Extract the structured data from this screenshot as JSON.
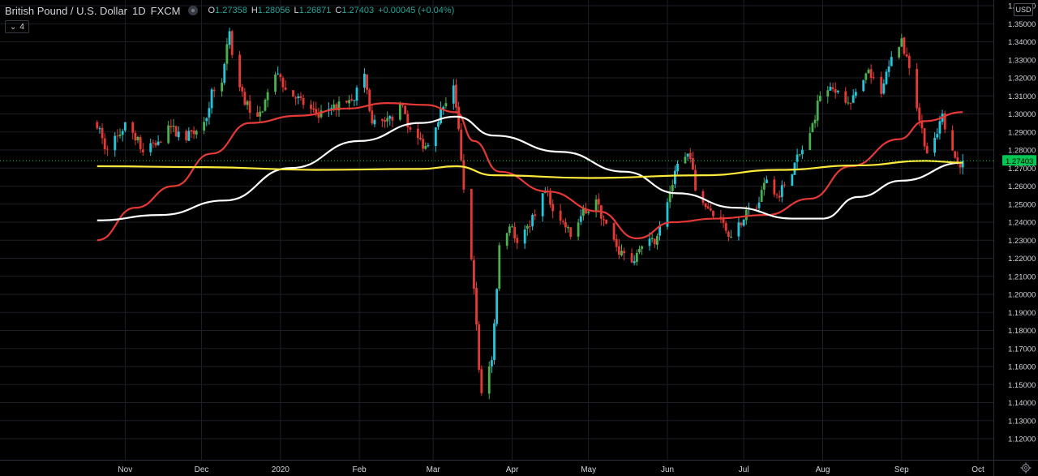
{
  "header": {
    "symbol": "British Pound / U.S. Dollar",
    "interval": "1D",
    "exchange": "FXCM",
    "o_label": "O",
    "o_val": "1.27358",
    "h_label": "H",
    "h_val": "1.28056",
    "l_label": "L",
    "l_val": "1.26871",
    "c_label": "C",
    "c_val": "1.27403",
    "change": "+0.00045 (+0.04%)"
  },
  "indicator_badge": "4",
  "currency": "USD",
  "colors": {
    "up": "#26c6da",
    "down": "#e53935",
    "up_alt": "#4caf50",
    "ema_red": "#e53935",
    "sma_white": "#ffffff",
    "sma_yellow": "#ffeb3b",
    "price_label_bg": "#00c853",
    "grid": "#1c1f26",
    "axis_text": "#d1d4dc"
  },
  "chart_data": {
    "type": "candlestick",
    "title": "British Pound / U.S. Dollar 1D FXCM",
    "x_ticks": [
      "Nov",
      "Dec",
      "2020",
      "Feb",
      "Mar",
      "Apr",
      "May",
      "Jun",
      "Jul",
      "Aug",
      "Sep",
      "Oct"
    ],
    "y_ticks": [
      "1.36000",
      "1.35000",
      "1.34000",
      "1.33000",
      "1.32000",
      "1.31000",
      "1.30000",
      "1.29000",
      "1.28000",
      "1.27000",
      "1.26000",
      "1.25000",
      "1.24000",
      "1.23000",
      "1.22000",
      "1.21000",
      "1.20000",
      "1.19000",
      "1.18000",
      "1.17000",
      "1.16000",
      "1.15000",
      "1.14000",
      "1.13000",
      "1.12000"
    ],
    "ylim": [
      1.12,
      1.36
    ],
    "last_price": "1.27403",
    "last_price_value": 1.27403,
    "close_path": [
      [
        "2019-10-21",
        1.295
      ],
      [
        "2019-10-24",
        1.282
      ],
      [
        "2019-10-29",
        1.287
      ],
      [
        "2019-11-01",
        1.294
      ],
      [
        "2019-11-05",
        1.288
      ],
      [
        "2019-11-08",
        1.278
      ],
      [
        "2019-11-13",
        1.284
      ],
      [
        "2019-11-19",
        1.292
      ],
      [
        "2019-11-25",
        1.287
      ],
      [
        "2019-11-29",
        1.292
      ],
      [
        "2019-12-02",
        1.294
      ],
      [
        "2019-12-05",
        1.312
      ],
      [
        "2019-12-09",
        1.317
      ],
      [
        "2019-12-12",
        1.345
      ],
      [
        "2019-12-13",
        1.33
      ],
      [
        "2019-12-18",
        1.308
      ],
      [
        "2019-12-23",
        1.296
      ],
      [
        "2019-12-27",
        1.311
      ],
      [
        "2019-12-31",
        1.324
      ],
      [
        "2020-01-03",
        1.313
      ],
      [
        "2020-01-09",
        1.307
      ],
      [
        "2020-01-14",
        1.3
      ],
      [
        "2020-01-20",
        1.301
      ],
      [
        "2020-01-24",
        1.305
      ],
      [
        "2020-01-30",
        1.31
      ],
      [
        "2020-02-03",
        1.322
      ],
      [
        "2020-02-06",
        1.294
      ],
      [
        "2020-02-12",
        1.296
      ],
      [
        "2020-02-18",
        1.305
      ],
      [
        "2020-02-21",
        1.29
      ],
      [
        "2020-02-27",
        1.282
      ],
      [
        "2020-03-03",
        1.298
      ],
      [
        "2020-03-09",
        1.317
      ],
      [
        "2020-03-11",
        1.29
      ],
      [
        "2020-03-13",
        1.256
      ],
      [
        "2020-03-17",
        1.205
      ],
      [
        "2020-03-19",
        1.16
      ],
      [
        "2020-03-20",
        1.145
      ],
      [
        "2020-03-24",
        1.165
      ],
      [
        "2020-03-27",
        1.225
      ],
      [
        "2020-03-31",
        1.24
      ],
      [
        "2020-04-03",
        1.227
      ],
      [
        "2020-04-08",
        1.24
      ],
      [
        "2020-04-14",
        1.256
      ],
      [
        "2020-04-20",
        1.242
      ],
      [
        "2020-04-24",
        1.233
      ],
      [
        "2020-04-29",
        1.245
      ],
      [
        "2020-05-04",
        1.251
      ],
      [
        "2020-05-08",
        1.238
      ],
      [
        "2020-05-13",
        1.224
      ],
      [
        "2020-05-18",
        1.218
      ],
      [
        "2020-05-21",
        1.225
      ],
      [
        "2020-05-27",
        1.23
      ],
      [
        "2020-06-01",
        1.253
      ],
      [
        "2020-06-05",
        1.27
      ],
      [
        "2020-06-10",
        1.278
      ],
      [
        "2020-06-12",
        1.256
      ],
      [
        "2020-06-17",
        1.248
      ],
      [
        "2020-06-22",
        1.242
      ],
      [
        "2020-06-26",
        1.231
      ],
      [
        "2020-06-30",
        1.241
      ],
      [
        "2020-07-06",
        1.25
      ],
      [
        "2020-07-10",
        1.262
      ],
      [
        "2020-07-15",
        1.256
      ],
      [
        "2020-07-21",
        1.272
      ],
      [
        "2020-07-27",
        1.288
      ],
      [
        "2020-07-31",
        1.311
      ],
      [
        "2020-08-05",
        1.313
      ],
      [
        "2020-08-10",
        1.306
      ],
      [
        "2020-08-14",
        1.31
      ],
      [
        "2020-08-19",
        1.323
      ],
      [
        "2020-08-24",
        1.31
      ],
      [
        "2020-08-28",
        1.334
      ],
      [
        "2020-09-01",
        1.339
      ],
      [
        "2020-09-04",
        1.327
      ],
      [
        "2020-09-08",
        1.297
      ],
      [
        "2020-09-11",
        1.279
      ],
      [
        "2020-09-14",
        1.284
      ],
      [
        "2020-09-17",
        1.298
      ],
      [
        "2020-09-21",
        1.28
      ],
      [
        "2020-09-23",
        1.272
      ],
      [
        "2020-09-25",
        1.27403
      ]
    ],
    "series": [
      {
        "name": "",
        "color": "#e53935",
        "values": [
          [
            "2019-10-21",
            1.23
          ],
          [
            "2019-11-05",
            1.248
          ],
          [
            "2019-11-20",
            1.26
          ],
          [
            "2019-12-05",
            1.278
          ],
          [
            "2019-12-20",
            1.295
          ],
          [
            "2020-01-08",
            1.299
          ],
          [
            "2020-01-27",
            1.303
          ],
          [
            "2020-02-12",
            1.306
          ],
          [
            "2020-02-27",
            1.305
          ],
          [
            "2020-03-10",
            1.301
          ],
          [
            "2020-03-17",
            1.285
          ],
          [
            "2020-03-27",
            1.268
          ],
          [
            "2020-04-15",
            1.257
          ],
          [
            "2020-05-05",
            1.246
          ],
          [
            "2020-05-20",
            1.231
          ],
          [
            "2020-06-03",
            1.24
          ],
          [
            "2020-06-20",
            1.242
          ],
          [
            "2020-07-10",
            1.244
          ],
          [
            "2020-07-27",
            1.253
          ],
          [
            "2020-08-12",
            1.271
          ],
          [
            "2020-08-31",
            1.286
          ],
          [
            "2020-09-10",
            1.296
          ],
          [
            "2020-09-25",
            1.301
          ]
        ]
      },
      {
        "name": "",
        "color": "#ffffff",
        "values": [
          [
            "2019-10-21",
            1.241
          ],
          [
            "2019-11-15",
            1.244
          ],
          [
            "2019-12-10",
            1.252
          ],
          [
            "2020-01-05",
            1.27
          ],
          [
            "2020-02-01",
            1.285
          ],
          [
            "2020-02-25",
            1.295
          ],
          [
            "2020-03-10",
            1.2985
          ],
          [
            "2020-03-25",
            1.288
          ],
          [
            "2020-04-20",
            1.279
          ],
          [
            "2020-05-15",
            1.268
          ],
          [
            "2020-06-05",
            1.256
          ],
          [
            "2020-06-28",
            1.248
          ],
          [
            "2020-07-20",
            1.242
          ],
          [
            "2020-08-01",
            1.242
          ],
          [
            "2020-08-15",
            1.254
          ],
          [
            "2020-09-01",
            1.263
          ],
          [
            "2020-09-25",
            1.273
          ]
        ]
      },
      {
        "name": "",
        "color": "#ffeb3b",
        "values": [
          [
            "2019-10-21",
            1.271
          ],
          [
            "2019-12-01",
            1.2705
          ],
          [
            "2020-01-15",
            1.269
          ],
          [
            "2020-02-25",
            1.2695
          ],
          [
            "2020-03-10",
            1.271
          ],
          [
            "2020-03-25",
            1.266
          ],
          [
            "2020-05-01",
            1.2645
          ],
          [
            "2020-06-15",
            1.266
          ],
          [
            "2020-07-15",
            1.269
          ],
          [
            "2020-08-15",
            1.2715
          ],
          [
            "2020-09-10",
            1.274
          ],
          [
            "2020-09-25",
            1.273
          ]
        ]
      }
    ]
  }
}
